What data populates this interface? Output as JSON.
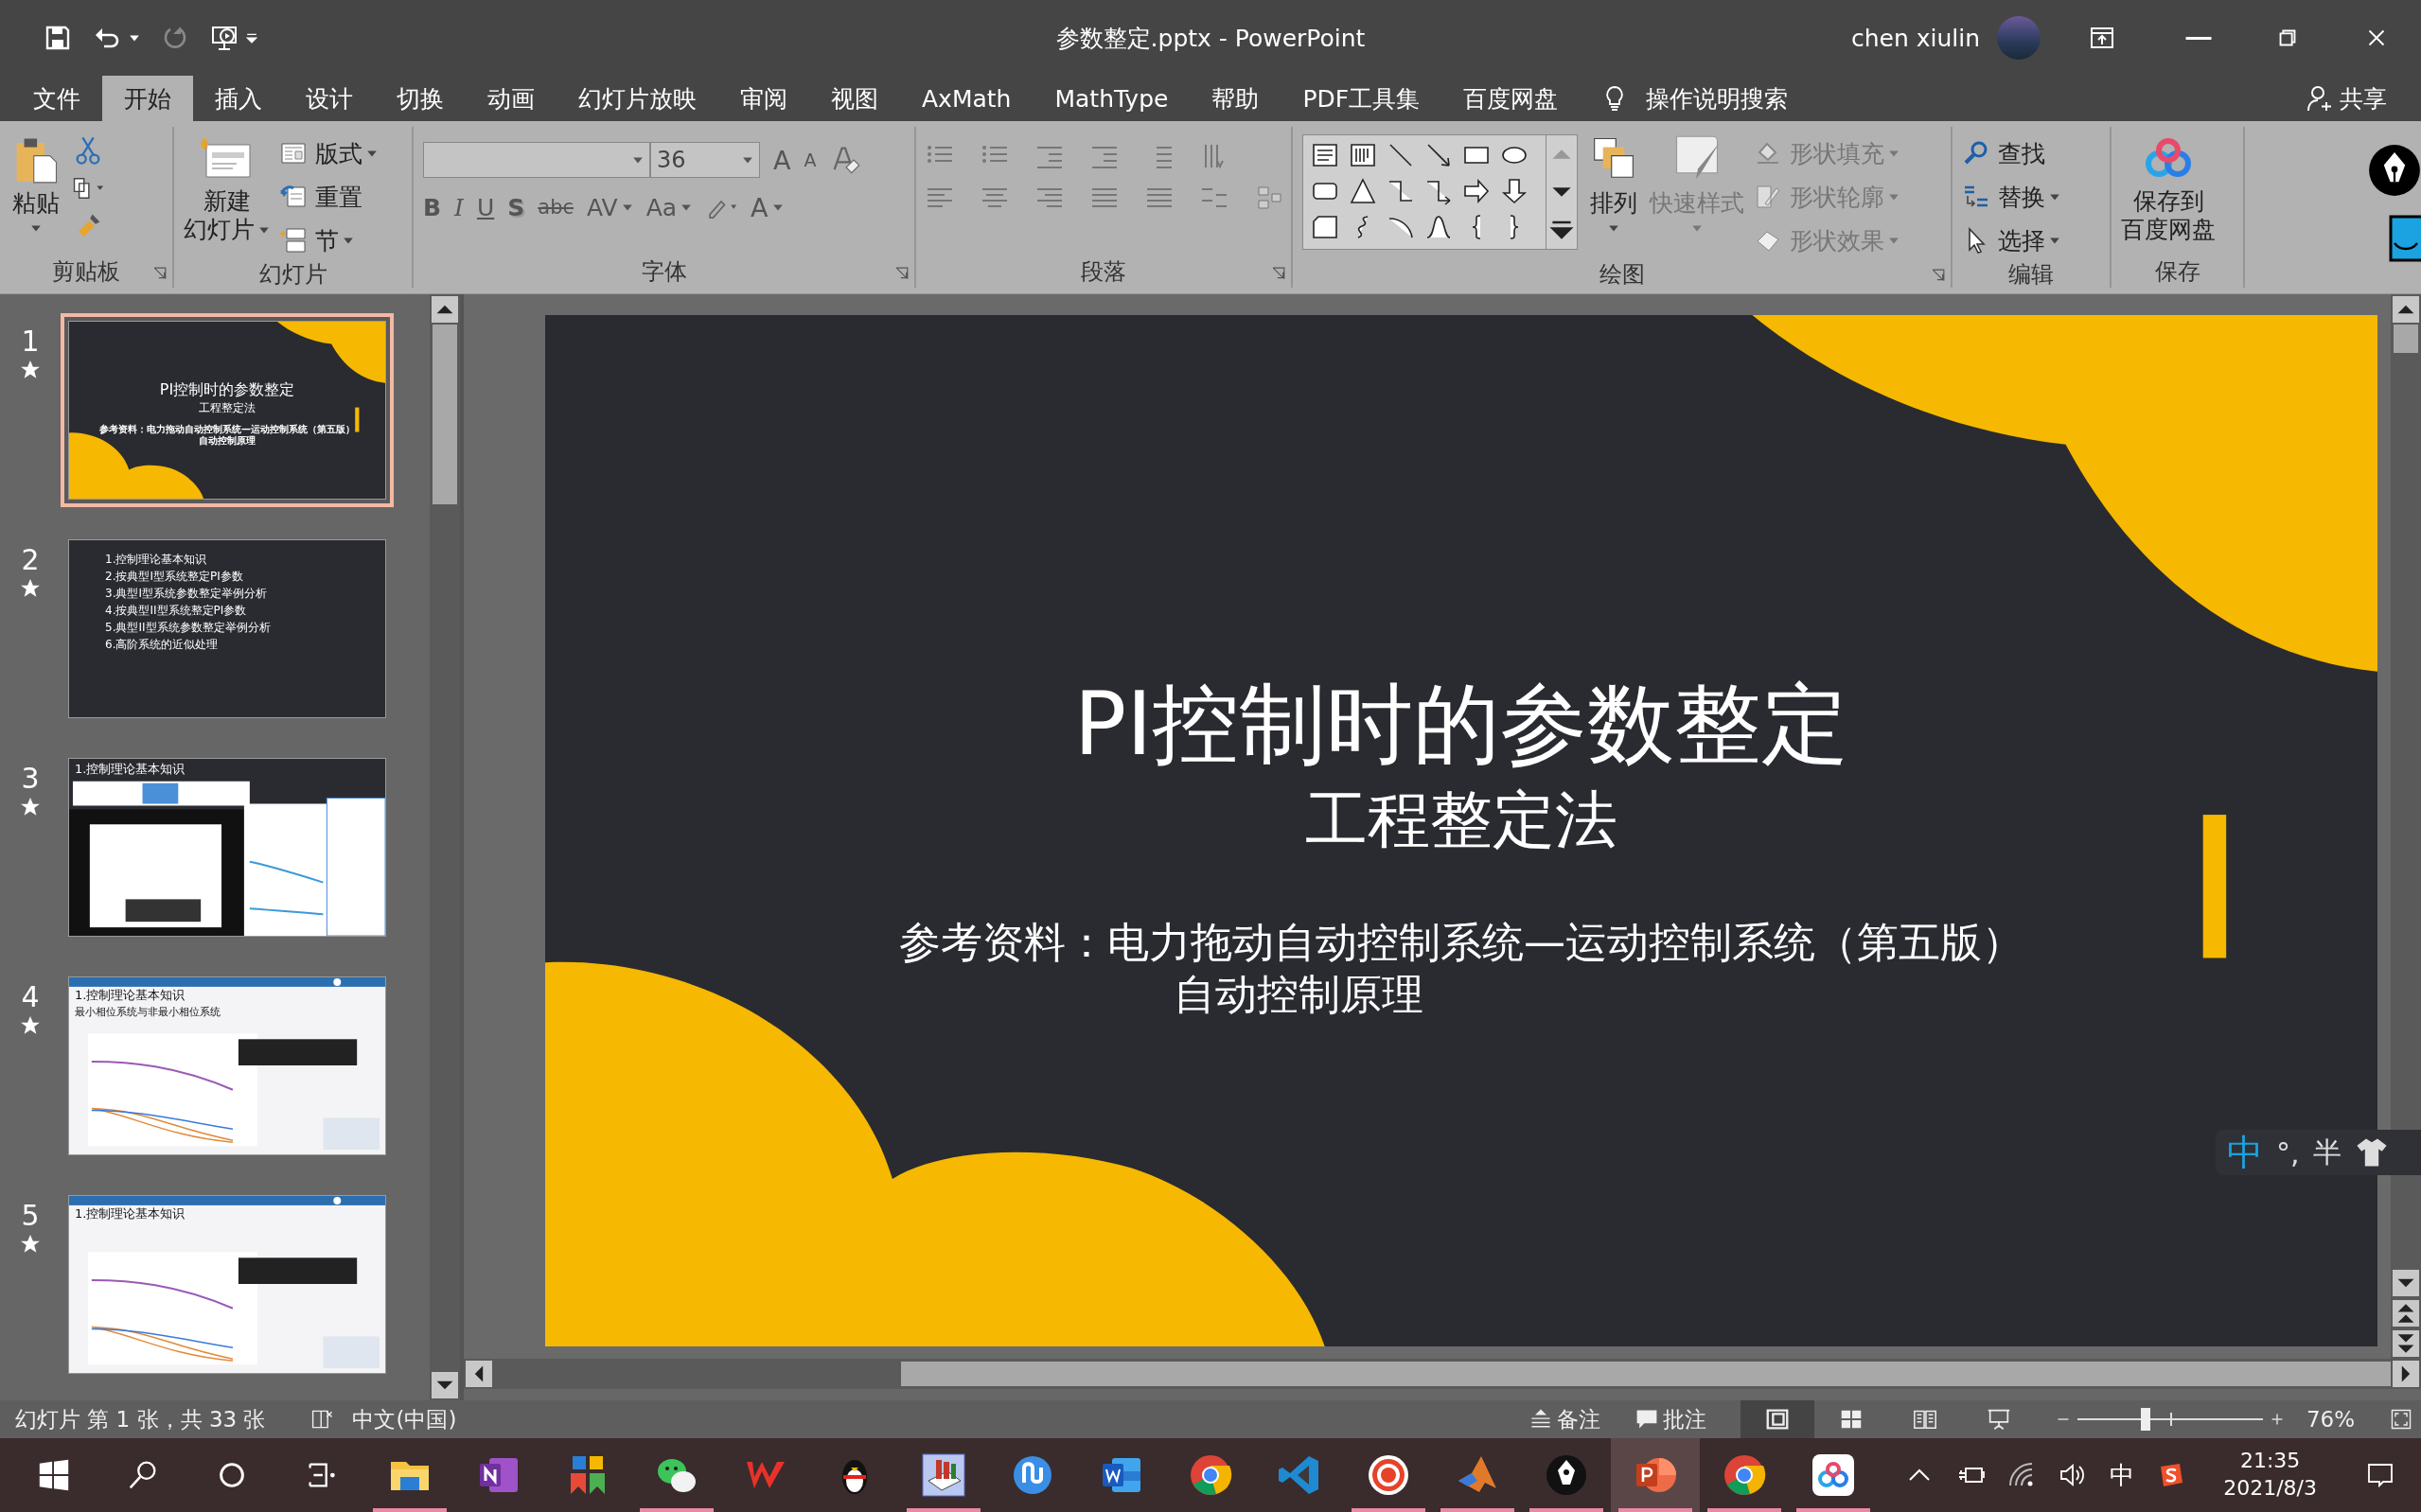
{
  "window": {
    "title": "参数整定.pptx  -  PowerPoint",
    "user": "chen xiulin"
  },
  "quick_access": {
    "redo_disabled": true
  },
  "tabs": [
    {
      "label": "文件",
      "selected": false
    },
    {
      "label": "开始",
      "selected": true
    },
    {
      "label": "插入",
      "selected": false
    },
    {
      "label": "设计",
      "selected": false
    },
    {
      "label": "切换",
      "selected": false
    },
    {
      "label": "动画",
      "selected": false
    },
    {
      "label": "幻灯片放映",
      "selected": false
    },
    {
      "label": "审阅",
      "selected": false
    },
    {
      "label": "视图",
      "selected": false
    },
    {
      "label": "AxMath",
      "selected": false
    },
    {
      "label": "MathType",
      "selected": false
    },
    {
      "label": "帮助",
      "selected": false
    },
    {
      "label": "PDF工具集",
      "selected": false
    },
    {
      "label": "百度网盘",
      "selected": false
    }
  ],
  "tell_me": "操作说明搜索",
  "share": "共享",
  "ribbon": {
    "clipboard": {
      "paste": "粘贴",
      "label": "剪贴板"
    },
    "slides": {
      "new_slide": "新建",
      "new_slide_2": "幻灯片",
      "layout": "版式",
      "reset": "重置",
      "section": "节",
      "label": "幻灯片"
    },
    "font": {
      "size": "36",
      "grow": "A",
      "shrink": "A",
      "bold": "B",
      "italic": "I",
      "underline": "U",
      "shadow": "S",
      "strike": "abc",
      "spacing": "AV",
      "case": "Aa",
      "text_color_button": "A",
      "label": "字体"
    },
    "paragraph": {
      "label": "段落"
    },
    "drawing": {
      "arrange": "排列",
      "quick_styles": {
        "label": "快速样式",
        "disabled": true
      },
      "format": [
        {
          "label": "形状填充",
          "disabled": true
        },
        {
          "label": "形状轮廓",
          "disabled": true
        },
        {
          "label": "形状效果",
          "disabled": true
        }
      ],
      "label": "绘图"
    },
    "editing": {
      "find": "查找",
      "replace": "替换",
      "select": "选择",
      "label": "编辑"
    },
    "save": {
      "line_1": "保存到",
      "line_2": "百度网盘",
      "label": "保存"
    }
  },
  "slides": [
    {
      "number": "1",
      "selected": true,
      "kind": "title",
      "title": "PI控制时的参数整定",
      "subtitle": "工程整定法",
      "reference": "参考资料：电力拖动自动控制系统—运动控制系统（第五版）",
      "reference_2": "自动控制原理"
    },
    {
      "number": "2",
      "selected": false,
      "kind": "list",
      "items": [
        "1.控制理论基本知识",
        "2.按典型I型系统整定PI参数",
        "3.典型I型系统参数整定举例分析",
        "4.按典型II型系统整定PI参数",
        "5.典型II型系统参数整定举例分析",
        "6.高阶系统的近似处理"
      ]
    },
    {
      "number": "3",
      "selected": false,
      "kind": "dark-screenshot",
      "heading": "1.控制理论基本知识"
    },
    {
      "number": "4",
      "selected": false,
      "kind": "light-screenshot",
      "heading": "1.控制理论基本知识",
      "subheading": "最小相位系统与非最小相位系统"
    },
    {
      "number": "5",
      "selected": false,
      "kind": "light-screenshot",
      "heading": "1.控制理论基本知识"
    }
  ],
  "slide": {
    "title": "PI控制时的参数整定",
    "subtitle": "工程整定法",
    "reference": "参考资料：电力拖动自动控制系统—运动控制系统（第五版）",
    "reference_2": "自动控制原理"
  },
  "ime": {
    "mode": "中",
    "punctuation": "°,",
    "width": "半"
  },
  "status_bar": {
    "slide_info": "幻灯片 第 1 张，共 33 张",
    "language": "中文(中国)",
    "notes": "备注",
    "comments": "批注",
    "views": [
      {
        "kind": "normal",
        "selected": true
      },
      {
        "kind": "sorter",
        "selected": false
      },
      {
        "kind": "reading",
        "selected": false
      },
      {
        "kind": "slideshow",
        "selected": false
      }
    ],
    "zoom": {
      "level": 0.37
    },
    "zoom_percent": "76%"
  },
  "taskbar": {
    "apps": [
      {
        "kind": "folder",
        "running": true,
        "active": false
      },
      {
        "kind": "notebook",
        "running": false,
        "active": false
      },
      {
        "kind": "tiles",
        "running": false,
        "active": false
      },
      {
        "kind": "chat",
        "running": true,
        "active": false
      },
      {
        "kind": "w-mark",
        "running": false,
        "active": false
      },
      {
        "kind": "penguin",
        "running": false,
        "active": false
      },
      {
        "kind": "book",
        "running": true,
        "active": false
      },
      {
        "kind": "ring",
        "running": false,
        "active": false
      },
      {
        "kind": "word",
        "running": false,
        "active": false
      },
      {
        "kind": "chrome",
        "running": false,
        "active": false
      },
      {
        "kind": "vscode",
        "running": false,
        "active": false
      },
      {
        "kind": "record",
        "running": true,
        "active": false
      },
      {
        "kind": "peak",
        "running": true,
        "active": false
      },
      {
        "kind": "pen",
        "running": true,
        "active": false
      },
      {
        "kind": "slides",
        "running": true,
        "active": true
      },
      {
        "kind": "chrome",
        "running": true,
        "active": false
      },
      {
        "kind": "cloud",
        "running": true,
        "active": false
      }
    ],
    "tray_ime": "中",
    "time": "21:35",
    "date": "2021/8/3"
  }
}
